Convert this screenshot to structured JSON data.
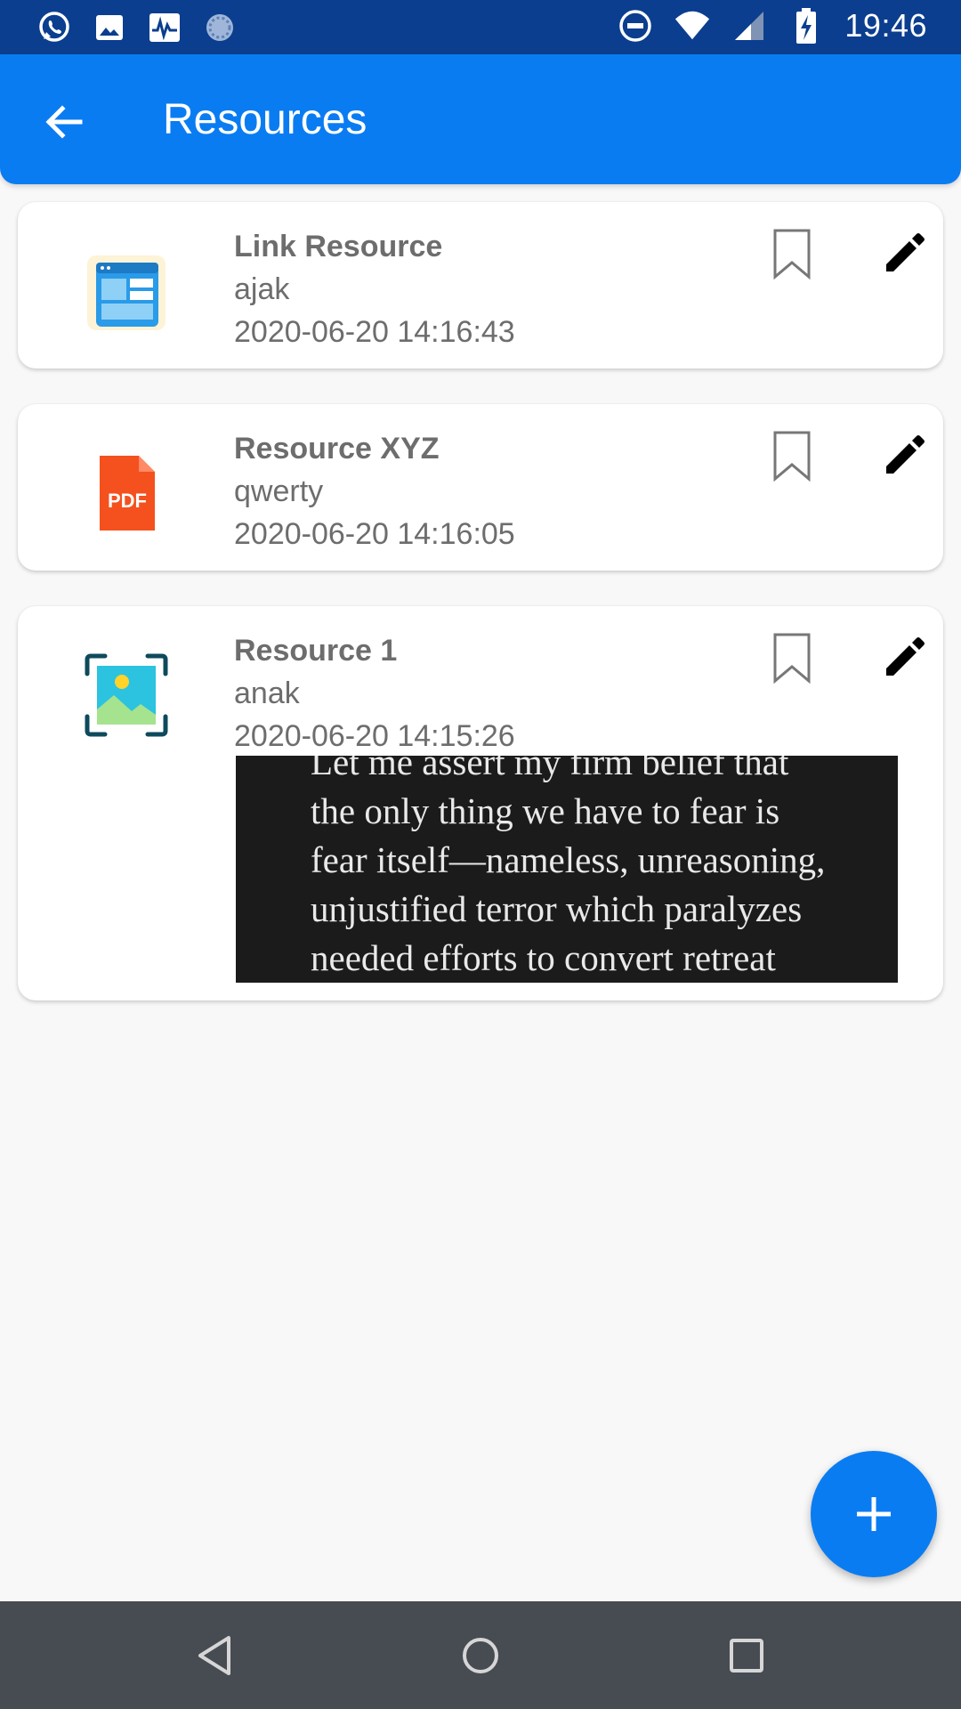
{
  "status_bar": {
    "time": "19:46",
    "left_icons": [
      "whatsapp-icon",
      "gallery-icon",
      "activity-icon",
      "sync-icon"
    ],
    "right_icons": [
      "dnd-icon",
      "wifi-icon",
      "signal-icon",
      "battery-charging-icon"
    ]
  },
  "app_bar": {
    "title": "Resources",
    "back_icon": "arrow-back-icon"
  },
  "resources": [
    {
      "title": "Link Resource",
      "subtitle": "ajak",
      "date": "2020-06-20 14:16:43",
      "thumb_icon": "web-layout-icon"
    },
    {
      "title": "Resource XYZ",
      "subtitle": "qwerty",
      "date": "2020-06-20 14:16:05",
      "thumb_icon": "pdf-file-icon",
      "thumb_label": "PDF"
    },
    {
      "title": "Resource 1",
      "subtitle": "anak",
      "date": "2020-06-20 14:15:26",
      "thumb_icon": "image-scan-icon",
      "preview_lines": [
        "Let me assert my firm belief that",
        "the only thing we have to fear is",
        "fear itself—nameless, unreasoning,",
        "unjustified terror which paralyzes",
        "needed efforts to convert retreat"
      ]
    }
  ],
  "fab": {
    "icon": "plus-icon"
  },
  "colors": {
    "status_bar": "#0b3e8e",
    "app_bar": "#0a7cf2",
    "background": "#f8f8f8",
    "nav_bar": "#474c53",
    "text_secondary": "#6d6d6d"
  }
}
